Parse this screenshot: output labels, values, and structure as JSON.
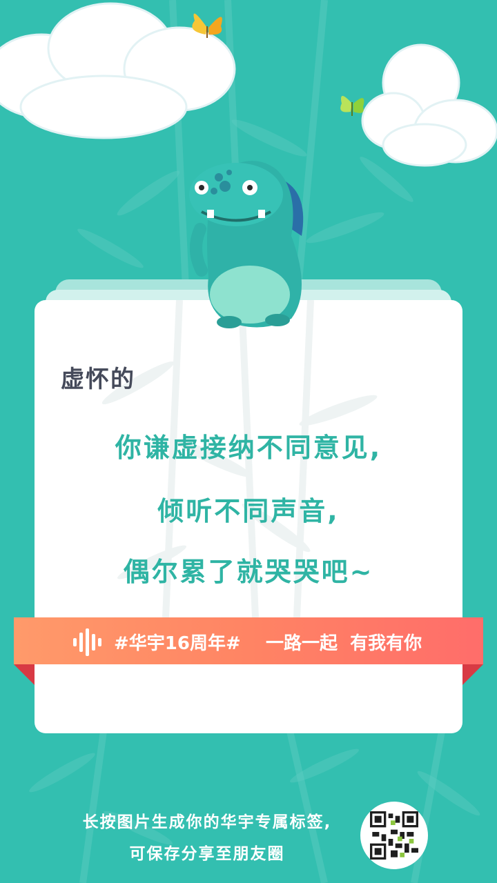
{
  "card": {
    "badge_title": "虚怀的",
    "quote_lines": [
      "你谦虚接纳不同意见,",
      "倾听不同声音,",
      "偶尔累了就哭哭吧~"
    ]
  },
  "ribbon": {
    "text": "#华宇16周年#    一路一起  有我有你"
  },
  "footer": {
    "line1": "长按图片生成你的华宇专属标签,",
    "line2": "可保存分享至朋友圈"
  },
  "colors": {
    "background": "#33bfb0",
    "quote_text": "#2fb4a4",
    "title_text": "#454a5a",
    "ribbon_start": "#ff9a6a",
    "ribbon_end": "#ff6d6a"
  },
  "icons": [
    "cloud-icon",
    "butterfly-icon",
    "monster-mascot-icon",
    "soundwave-logo-icon",
    "qr-code-icon"
  ]
}
